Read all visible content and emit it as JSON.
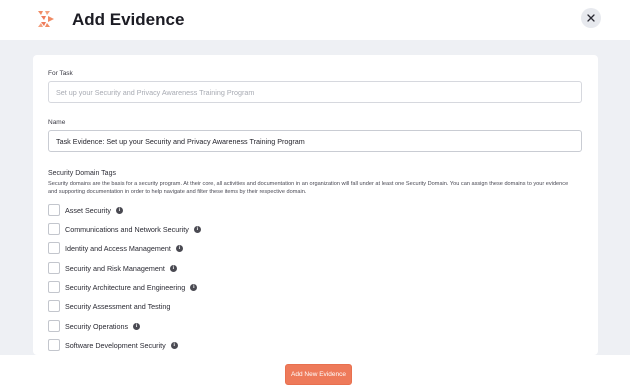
{
  "header": {
    "title": "Add Evidence",
    "logo_icon": "brand-logo-icon",
    "close_icon": "close-icon"
  },
  "form": {
    "task": {
      "label": "For Task",
      "value": "Set up your Security and Privacy Awareness Training Program"
    },
    "name": {
      "label": "Name",
      "value": "Task Evidence: Set up your Security and Privacy Awareness Training Program"
    },
    "tags": {
      "title": "Security Domain Tags",
      "description": "Security domains are the basis for a security program. At their core, all activities and documentation in an organization will fall under at least one Security Domain. You can assign these domains to your evidence and supporting documentation in order to help navigate and filter these items by their respective domain.",
      "items": [
        {
          "label": "Asset Security",
          "info": true,
          "checked": false
        },
        {
          "label": "Communications and Network Security",
          "info": true,
          "checked": false
        },
        {
          "label": "Identity and Access Management",
          "info": true,
          "checked": false
        },
        {
          "label": "Security and Risk Management",
          "info": true,
          "checked": false
        },
        {
          "label": "Security Architecture and Engineering",
          "info": true,
          "checked": false
        },
        {
          "label": "Security Assessment and Testing",
          "info": false,
          "checked": false
        },
        {
          "label": "Security Operations",
          "info": true,
          "checked": false
        },
        {
          "label": "Software Development Security",
          "info": true,
          "checked": false
        }
      ]
    }
  },
  "footer": {
    "submit_label": "Add New Evidence"
  },
  "colors": {
    "accent": "#ee7a5a",
    "background": "#eef0f4"
  }
}
